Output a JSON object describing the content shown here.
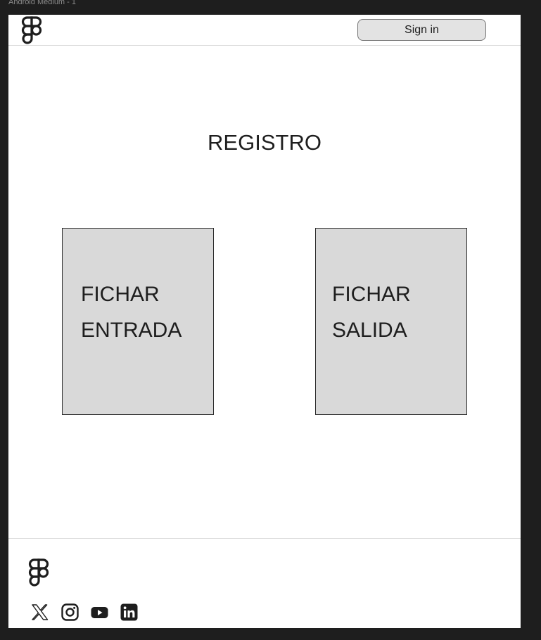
{
  "frame": {
    "label": "Android Medium - 1"
  },
  "header": {
    "logo_icon": "figma-logo-icon",
    "signin_label": "Sign in"
  },
  "main": {
    "title": "REGISTRO",
    "cards": [
      {
        "line1": "FICHAR",
        "line2": "ENTRADA"
      },
      {
        "line1": "FICHAR",
        "line2": "SALIDA"
      }
    ]
  },
  "footer": {
    "logo_icon": "figma-logo-icon",
    "social_icons": [
      "x-icon",
      "instagram-icon",
      "youtube-icon",
      "linkedin-icon"
    ]
  },
  "colors": {
    "background": "#1e1e1e",
    "frame": "#ffffff",
    "card": "#d9d9d9",
    "button": "#e3e3e3",
    "text": "#1e1e1e"
  }
}
